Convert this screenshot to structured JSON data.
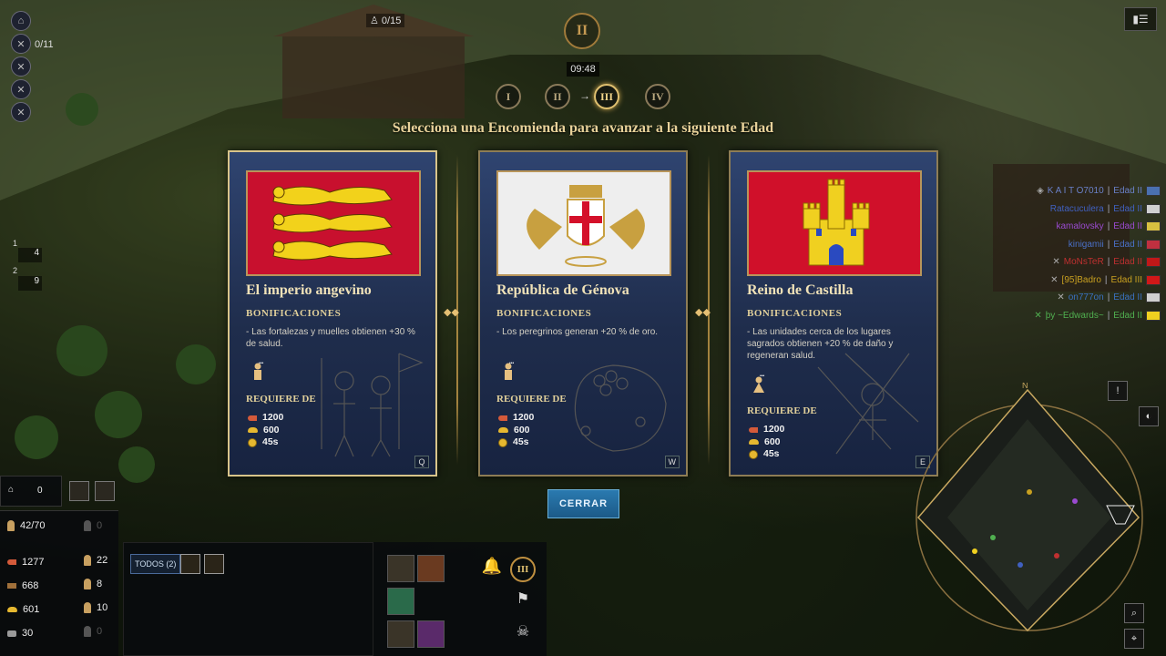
{
  "hud": {
    "idle_villagers": "0/11",
    "population_top": "0/15",
    "timer": "09:48",
    "current_age_numeral": "II",
    "age_numerals": [
      "I",
      "II",
      "III",
      "IV"
    ],
    "group_1": "4",
    "group_2": "9",
    "group_1_key": "1",
    "group_2_key": "2"
  },
  "headline": "Selecciona una Encomienda para avanzar a la siguiente Edad",
  "cards": [
    {
      "title": "El imperio angevino",
      "bonus_heading": "BONIFICACIONES",
      "bonus_text": "- Las fortalezas y muelles obtienen +30 % de salud.",
      "requires_heading": "REQUIERE DE",
      "food": "1200",
      "gold": "600",
      "time": "45s",
      "hotkey": "Q",
      "flag_colors": {
        "field": "#c8102e",
        "charge": "#f2d21b"
      }
    },
    {
      "title": "República de Génova",
      "bonus_heading": "BONIFICACIONES",
      "bonus_text": "- Los peregrinos generan +20 % de oro.",
      "requires_heading": "REQUIERE DE",
      "food": "1200",
      "gold": "600",
      "time": "45s",
      "hotkey": "W",
      "flag_colors": {
        "field": "#f4f4f4",
        "cross": "#d4102a",
        "ornament": "#c8a040"
      }
    },
    {
      "title": "Reino de Castilla",
      "bonus_heading": "BONIFICACIONES",
      "bonus_text": "- Las unidades cerca de los lugares sagrados obtienen +20 % de daño y regeneran salud.",
      "requires_heading": "REQUIERE DE",
      "food": "1200",
      "gold": "600",
      "time": "45s",
      "hotkey": "E",
      "flag_colors": {
        "field": "#d0102a",
        "castle": "#f0d020"
      }
    }
  ],
  "close_label": "CERRAR",
  "players": [
    {
      "name": "K A I T O7010",
      "age": "Edad II",
      "color": "#6a80c8"
    },
    {
      "name": "Ratacuculera",
      "age": "Edad II",
      "color": "#4060c0"
    },
    {
      "name": "kamalovsky",
      "age": "Edad II",
      "color": "#9a4ad0"
    },
    {
      "name": "kinigamii",
      "age": "Edad II",
      "color": "#4a70c8"
    },
    {
      "name": "MoNsTeR",
      "age": "Edad II",
      "color": "#c03030"
    },
    {
      "name": "[95]Badro",
      "age": "Edad III",
      "color": "#c8a020"
    },
    {
      "name": "on777on",
      "age": "Edad II",
      "color": "#3a70c0"
    },
    {
      "name": "þy ~Edwards~",
      "age": "Edad II",
      "color": "#50b050"
    }
  ],
  "bottom_left": {
    "town_centers": "0",
    "population": "42/70",
    "pop_idle": "0",
    "food": "1277",
    "wood": "668",
    "gold": "601",
    "stone": "30",
    "food_vill": "22",
    "wood_vill": "8",
    "gold_vill": "10",
    "stone_vill": "0"
  },
  "selection": {
    "all_label": "TODOS (2)",
    "age_numeral": "III"
  },
  "minimap_north": "N"
}
